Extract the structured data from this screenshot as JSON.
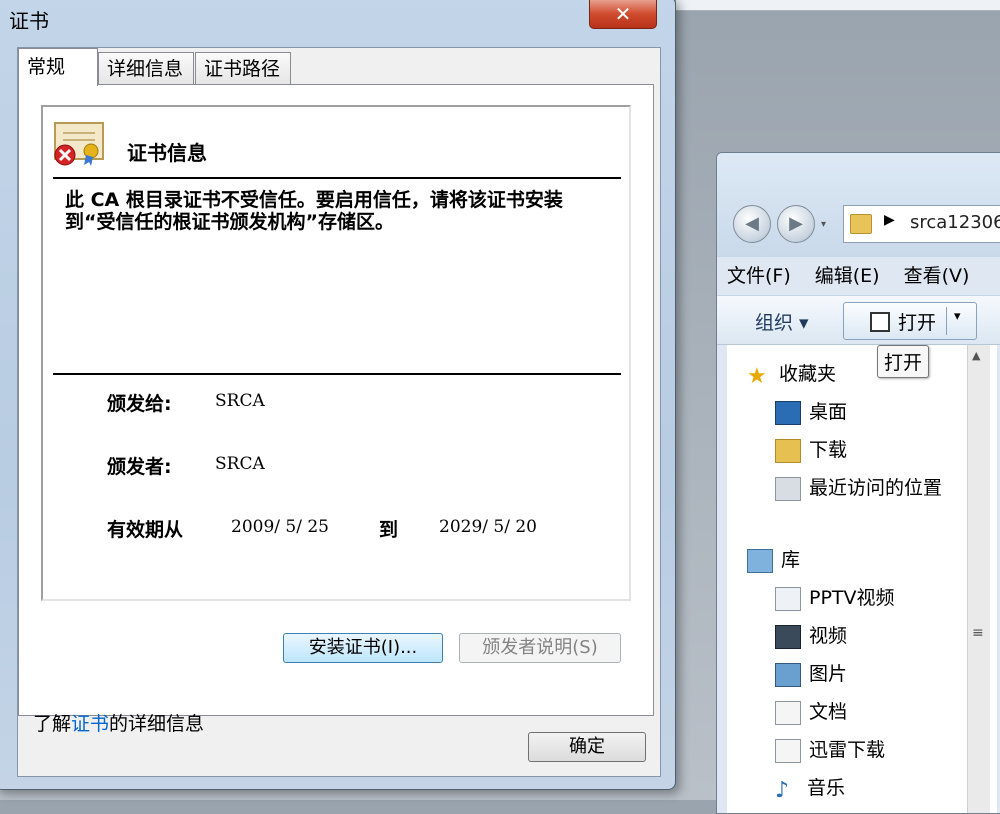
{
  "dialog": {
    "title": "证书",
    "close_symbol": "✕",
    "tabs": [
      {
        "label": "常规"
      },
      {
        "label": "详细信息"
      },
      {
        "label": "证书路径"
      }
    ],
    "info_title": "证书信息",
    "warning": "此 CA 根目录证书不受信任。要启用信任，请将该证书安装到“受信任的根证书颁发机构”存储区。",
    "issued_to_label": "颁发给:",
    "issued_to_value": "SRCA",
    "issued_by_label": "颁发者:",
    "issued_by_value": "SRCA",
    "validity_label": "有效期从",
    "valid_from": "2009/ 5/ 25",
    "to_label": "到",
    "valid_to": "2029/ 5/ 20",
    "install_button": "安装证书(I)...",
    "issuer_statement_button": "颁发者说明(S)",
    "learn_prefix": "了解",
    "learn_link": "证书",
    "learn_suffix": "的详细信息",
    "ok_button": "确定"
  },
  "explorer": {
    "back_symbol": "◀",
    "forward_symbol": "▶",
    "dropdown_symbol": "▾",
    "address_arrow": "▶",
    "address_text": "srca12306",
    "menu": [
      "文件(F)",
      "编辑(E)",
      "查看(V)"
    ],
    "organize": "组织 ▾",
    "open_button": "打开",
    "open_dropdown": "▾",
    "tooltip": "打开",
    "favorites": "收藏夹",
    "fav_items": [
      "桌面",
      "下载",
      "最近访问的位置"
    ],
    "library": "库",
    "lib_items": [
      "PPTV视频",
      "视频",
      "图片",
      "文档",
      "迅雷下载",
      "音乐"
    ],
    "scroll_up": "▲",
    "scroll_grip": "≡"
  }
}
